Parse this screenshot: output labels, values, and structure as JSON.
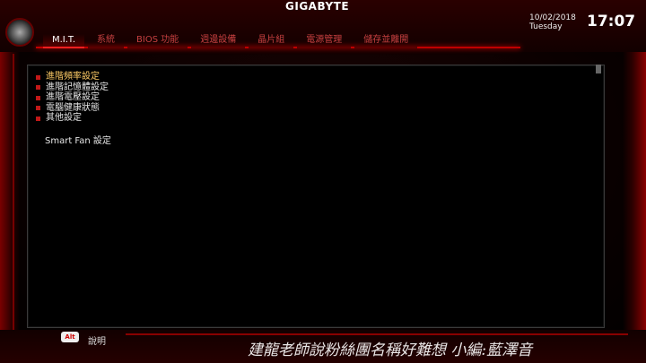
{
  "brand": "GIGABYTE",
  "tabs": [
    {
      "label": "M.I.T."
    },
    {
      "label": "系統"
    },
    {
      "label": "BIOS 功能"
    },
    {
      "label": "週邊設備"
    },
    {
      "label": "晶片組"
    },
    {
      "label": "電源管理"
    },
    {
      "label": "儲存並離開"
    }
  ],
  "datetime": {
    "date": "10/02/2018",
    "weekday": "Tuesday",
    "time": "17:07"
  },
  "menu": {
    "items": [
      {
        "label": "進階頻率設定"
      },
      {
        "label": "進階記憶體設定"
      },
      {
        "label": "進階電壓設定"
      },
      {
        "label": "電腦健康狀態"
      },
      {
        "label": "其他設定"
      }
    ],
    "smart_fan": "Smart Fan 設定"
  },
  "footer": {
    "alt_key": "Alt",
    "help_label": "說明"
  },
  "watermark": "建龍老師說粉絲團名稱好難想 小編:藍澤音",
  "colors": {
    "accent": "#c00000",
    "selected_text": "#ffcc66"
  }
}
